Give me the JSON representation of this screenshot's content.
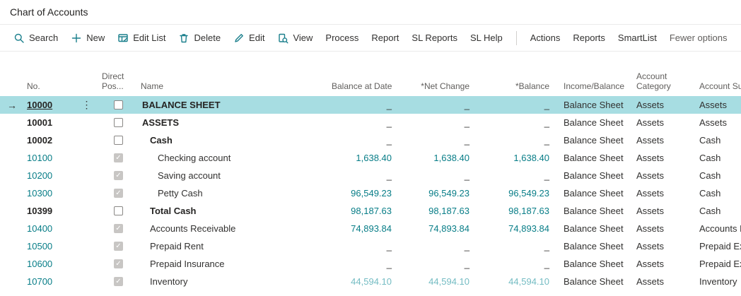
{
  "page": {
    "title": "Chart of Accounts"
  },
  "colors": {
    "accent_teal": "#077d87",
    "selected_row_bg": "#a7dde2",
    "muted_amount": "#74bcc3",
    "header_text": "#605e5c"
  },
  "toolbar": {
    "items": [
      {
        "label": "Search",
        "icon": "search-icon"
      },
      {
        "label": "New",
        "icon": "plus-icon"
      },
      {
        "label": "Edit List",
        "icon": "edit-list-icon"
      },
      {
        "label": "Delete",
        "icon": "delete-icon"
      },
      {
        "label": "Edit",
        "icon": "edit-icon"
      },
      {
        "label": "View",
        "icon": "view-icon"
      },
      {
        "label": "Process"
      },
      {
        "label": "Report"
      },
      {
        "label": "SL Reports"
      },
      {
        "label": "SL Help"
      },
      {
        "type": "divider"
      },
      {
        "label": "Actions"
      },
      {
        "label": "Reports"
      },
      {
        "label": "SmartList"
      },
      {
        "label": "Fewer options",
        "muted": true
      }
    ]
  },
  "table": {
    "columns": [
      "No.",
      "Direct Pos...",
      "Name",
      "Balance at Date",
      "*Net Change",
      "*Balance",
      "Income/Balance",
      "Account Category",
      "Account Subcategory"
    ],
    "rows": [
      {
        "no": "10000",
        "selected": true,
        "focused": true,
        "heading": true,
        "direct_posting": false,
        "name": "BALANCE SHEET",
        "indent": 0,
        "balance_at_date": "_",
        "net_change": "_",
        "balance": "_",
        "income_balance": "Balance Sheet",
        "account_category": "Assets",
        "account_subcategory": "Assets"
      },
      {
        "no": "10001",
        "heading": true,
        "direct_posting": false,
        "name": "ASSETS",
        "indent": 0,
        "balance_at_date": "_",
        "net_change": "_",
        "balance": "_",
        "income_balance": "Balance Sheet",
        "account_category": "Assets",
        "account_subcategory": "Assets"
      },
      {
        "no": "10002",
        "heading": true,
        "direct_posting": false,
        "name": "Cash",
        "indent": 1,
        "balance_at_date": "_",
        "net_change": "_",
        "balance": "_",
        "income_balance": "Balance Sheet",
        "account_category": "Assets",
        "account_subcategory": "Cash"
      },
      {
        "no": "10100",
        "direct_posting": true,
        "name": "Checking account",
        "indent": 2,
        "balance_at_date": "1,638.40",
        "net_change": "1,638.40",
        "balance": "1,638.40",
        "income_balance": "Balance Sheet",
        "account_category": "Assets",
        "account_subcategory": "Cash"
      },
      {
        "no": "10200",
        "direct_posting": true,
        "name": "Saving account",
        "indent": 2,
        "balance_at_date": "_",
        "net_change": "_",
        "balance": "_",
        "income_balance": "Balance Sheet",
        "account_category": "Assets",
        "account_subcategory": "Cash"
      },
      {
        "no": "10300",
        "direct_posting": true,
        "name": "Petty Cash",
        "indent": 2,
        "balance_at_date": "96,549.23",
        "net_change": "96,549.23",
        "balance": "96,549.23",
        "income_balance": "Balance Sheet",
        "account_category": "Assets",
        "account_subcategory": "Cash"
      },
      {
        "no": "10399",
        "heading": true,
        "direct_posting": false,
        "name": "Total Cash",
        "indent": 1,
        "balance_at_date": "98,187.63",
        "net_change": "98,187.63",
        "balance": "98,187.63",
        "income_balance": "Balance Sheet",
        "account_category": "Assets",
        "account_subcategory": "Cash"
      },
      {
        "no": "10400",
        "direct_posting": true,
        "name": "Accounts Receivable",
        "indent": 1,
        "balance_at_date": "74,893.84",
        "net_change": "74,893.84",
        "balance": "74,893.84",
        "income_balance": "Balance Sheet",
        "account_category": "Assets",
        "account_subcategory": "Accounts Receivable"
      },
      {
        "no": "10500",
        "direct_posting": true,
        "name": "Prepaid Rent",
        "indent": 1,
        "balance_at_date": "_",
        "net_change": "_",
        "balance": "_",
        "income_balance": "Balance Sheet",
        "account_category": "Assets",
        "account_subcategory": "Prepaid Expenses"
      },
      {
        "no": "10600",
        "direct_posting": true,
        "name": "Prepaid Insurance",
        "indent": 1,
        "balance_at_date": "_",
        "net_change": "_",
        "balance": "_",
        "income_balance": "Balance Sheet",
        "account_category": "Assets",
        "account_subcategory": "Prepaid Expenses"
      },
      {
        "no": "10700",
        "direct_posting": true,
        "name": "Inventory",
        "indent": 1,
        "muted_values": true,
        "balance_at_date": "44,594.10",
        "net_change": "44,594.10",
        "balance": "44,594.10",
        "income_balance": "Balance Sheet",
        "account_category": "Assets",
        "account_subcategory": "Inventory"
      }
    ]
  }
}
